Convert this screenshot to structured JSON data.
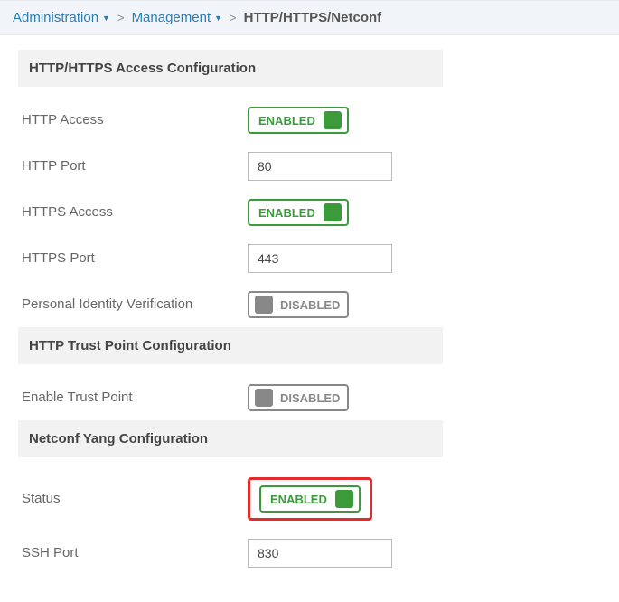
{
  "breadcrumb": {
    "administration": "Administration",
    "management": "Management",
    "current": "HTTP/HTTPS/Netconf",
    "sep": ">"
  },
  "toggle_labels": {
    "enabled": "ENABLED",
    "disabled": "DISABLED"
  },
  "sections": {
    "access": {
      "header": "HTTP/HTTPS Access Configuration",
      "http_access_label": "HTTP Access",
      "http_access_state": "enabled",
      "http_port_label": "HTTP Port",
      "http_port_value": "80",
      "https_access_label": "HTTPS Access",
      "https_access_state": "enabled",
      "https_port_label": "HTTPS Port",
      "https_port_value": "443",
      "piv_label": "Personal Identity Verification",
      "piv_state": "disabled"
    },
    "trust": {
      "header": "HTTP Trust Point Configuration",
      "enable_tp_label": "Enable Trust Point",
      "enable_tp_state": "disabled"
    },
    "netconf": {
      "header": "Netconf Yang Configuration",
      "status_label": "Status",
      "status_state": "enabled",
      "ssh_port_label": "SSH Port",
      "ssh_port_value": "830"
    }
  }
}
